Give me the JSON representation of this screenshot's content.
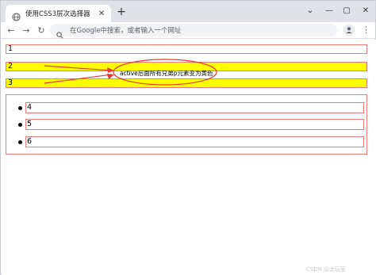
{
  "browser": {
    "tab_title": "使用CSS3层次选择器",
    "new_tab_symbol": "+",
    "window_controls": {
      "minimize": "—",
      "maximize": "▢",
      "close": "✕"
    },
    "address_placeholder": "在Google中搜索，或者输入一个网址"
  },
  "page": {
    "paragraphs": [
      {
        "text": "1",
        "highlighted": false
      },
      {
        "text": "2",
        "highlighted": true
      },
      {
        "text": "3",
        "highlighted": true
      }
    ],
    "list_items": [
      {
        "text": "4"
      },
      {
        "text": "5"
      },
      {
        "text": "6"
      }
    ],
    "annotation": "active后面所有兄弟p元素变为黄色"
  },
  "watermark": "CSDN @太玩家",
  "colors": {
    "highlight": "#ffff00",
    "border": "#ef7a7a",
    "annotation": "#e53935"
  },
  "icons": {
    "tab_favicon": "globe-icon",
    "search": "search-icon",
    "profile": "person-icon"
  }
}
